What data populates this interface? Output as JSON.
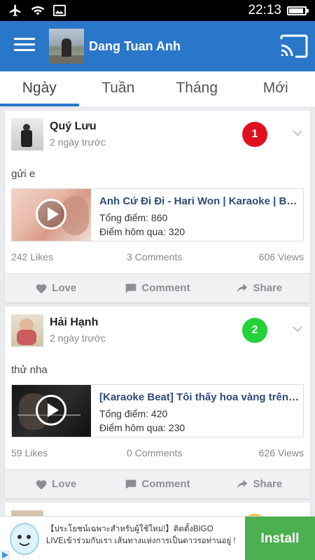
{
  "status_bar": {
    "time": "22:13",
    "icons": [
      "airplane-icon",
      "wifi-icon",
      "image-icon"
    ],
    "battery_level": 0.85
  },
  "app_bar": {
    "username": "Dang Tuan Anh",
    "menu_icon": "hamburger-icon",
    "cast_icon": "cast-icon"
  },
  "tabs": [
    {
      "label": "Ngày",
      "active": true
    },
    {
      "label": "Tuần",
      "active": false
    },
    {
      "label": "Tháng",
      "active": false
    },
    {
      "label": "Mới",
      "active": false
    }
  ],
  "posts": [
    {
      "user": "Quý Lưu",
      "time": "2 ngày trước",
      "rank": "1",
      "rank_color": "#e0111f",
      "text": "gửi e",
      "video": {
        "title": "Anh Cứ Đi Đi - Hari Won | Karaoke | Beat",
        "total_score": "Tổng điểm: 860",
        "yesterday_score": "Điểm hôm qua: 320"
      },
      "likes": "242 Likes",
      "comments": "3 Comments",
      "views": "606 Views"
    },
    {
      "user": "Hải Hạnh",
      "time": "2 ngày trước",
      "rank": "2",
      "rank_color": "#23d23a",
      "text": "thử nha",
      "video": {
        "title": "[Karaoke Beat] Tôi thấy hoa vàng trên cỏ xanh",
        "total_score": "Tổng điểm: 420",
        "yesterday_score": "Điểm hôm qua: 230"
      },
      "likes": "59 Likes",
      "comments": "0 Comments",
      "views": "626 Views"
    }
  ],
  "actions": {
    "love": "Love",
    "comment": "Comment",
    "share": "Share"
  },
  "ad": {
    "text": "【ประโยชน์เฉพาะสำหรับผู้ใช้ใหม่!】ติดตั้งBIGO LIVEเข้าร่วมกับเรา เส้นทางแห่งการเป็นดาวรอท่านอยู่ !",
    "install": "Install"
  },
  "colors": {
    "primary": "#2a77c9",
    "install": "#4caf50",
    "link": "#2e4b79"
  }
}
